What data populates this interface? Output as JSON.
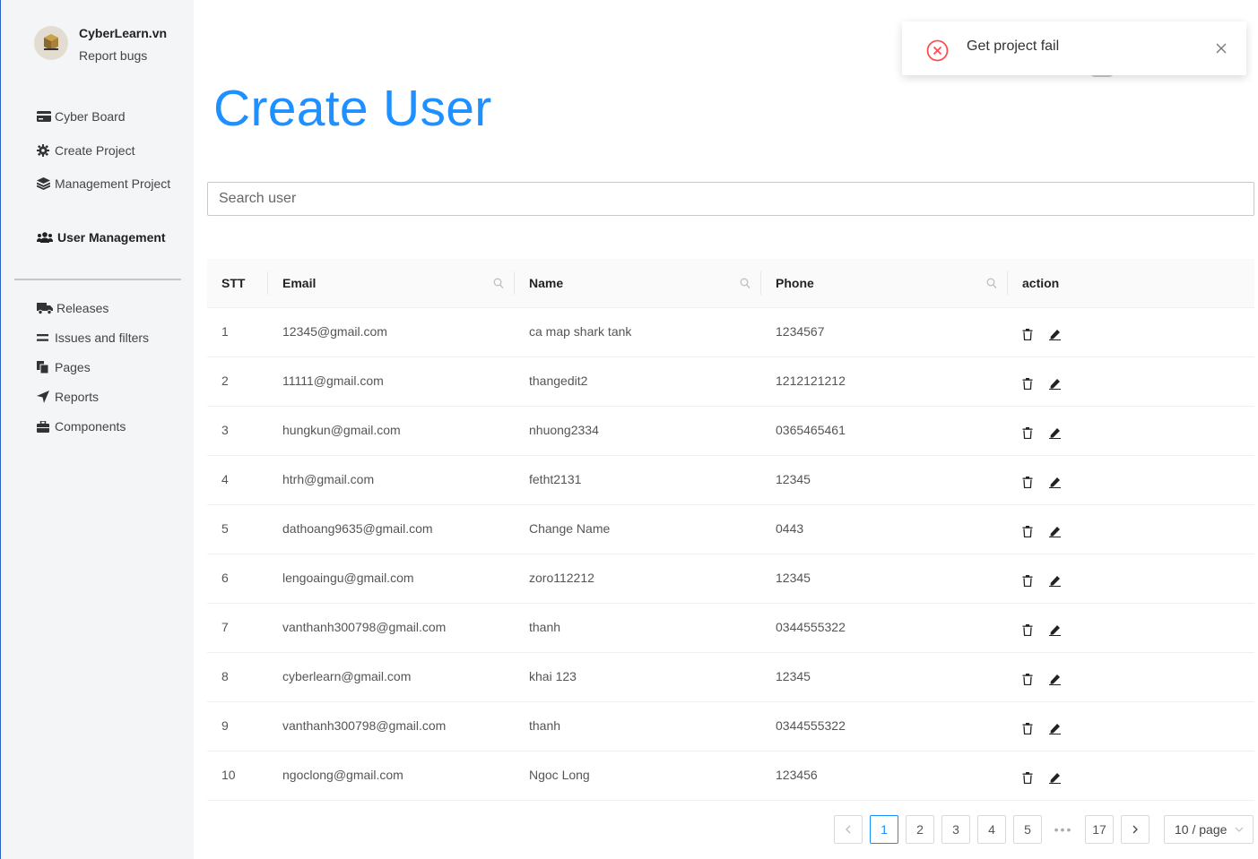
{
  "brand": {
    "name": "CyberLearn.vn",
    "subtitle": "Report bugs",
    "avatar_icon": "box-logo-icon"
  },
  "sidebar": {
    "top_items": [
      {
        "label": "Cyber Board",
        "icon": "credit-card-icon"
      },
      {
        "label": "Create Project",
        "icon": "gear-icon"
      },
      {
        "label": "Management Project",
        "icon": "layers-icon"
      },
      {
        "label": "User Management",
        "icon": "users-icon",
        "active": true
      }
    ],
    "bottom_items": [
      {
        "label": "Releases",
        "icon": "truck-icon"
      },
      {
        "label": "Issues and filters",
        "icon": "equals-icon"
      },
      {
        "label": "Pages",
        "icon": "copy-icon"
      },
      {
        "label": "Reports",
        "icon": "location-arrow-icon"
      },
      {
        "label": "Components",
        "icon": "briefcase-icon"
      }
    ]
  },
  "page": {
    "title": "Create User"
  },
  "search": {
    "placeholder": "Search user"
  },
  "table": {
    "columns": [
      "STT",
      "Email",
      "Name",
      "Phone",
      "action"
    ],
    "rows": [
      {
        "stt": "1",
        "email": "12345@gmail.com",
        "name": "ca map shark tank",
        "phone": "1234567"
      },
      {
        "stt": "2",
        "email": "11111@gmail.com",
        "name": "thangedit2",
        "phone": "1212121212"
      },
      {
        "stt": "3",
        "email": "hungkun@gmail.com",
        "name": "nhuong2334",
        "phone": "0365465461"
      },
      {
        "stt": "4",
        "email": "htrh@gmail.com",
        "name": "fetht2131",
        "phone": "12345"
      },
      {
        "stt": "5",
        "email": "dathoang9635@gmail.com",
        "name": "Change Name",
        "phone": "0443"
      },
      {
        "stt": "6",
        "email": "lengoaingu@gmail.com",
        "name": "zoro112212",
        "phone": "12345"
      },
      {
        "stt": "7",
        "email": "vanthanh300798@gmail.com",
        "name": "thanh",
        "phone": "0344555322"
      },
      {
        "stt": "8",
        "email": "cyberlearn@gmail.com",
        "name": "khai 123",
        "phone": "12345"
      },
      {
        "stt": "9",
        "email": "vanthanh300798@gmail.com",
        "name": "thanh",
        "phone": "0344555322"
      },
      {
        "stt": "10",
        "email": "ngoclong@gmail.com",
        "name": "Ngoc Long",
        "phone": "123456"
      }
    ]
  },
  "pagination": {
    "pages": [
      "1",
      "2",
      "3",
      "4",
      "5"
    ],
    "ellipsis": "•••",
    "last": "17",
    "current": "1",
    "page_size": "10 / page"
  },
  "toast": {
    "message": "Get project fail",
    "accent": "#ff4d4f"
  },
  "colors": {
    "title": "#1e90ff",
    "sidebar_bg": "#f4f5f7",
    "active_page": "#1890ff"
  }
}
